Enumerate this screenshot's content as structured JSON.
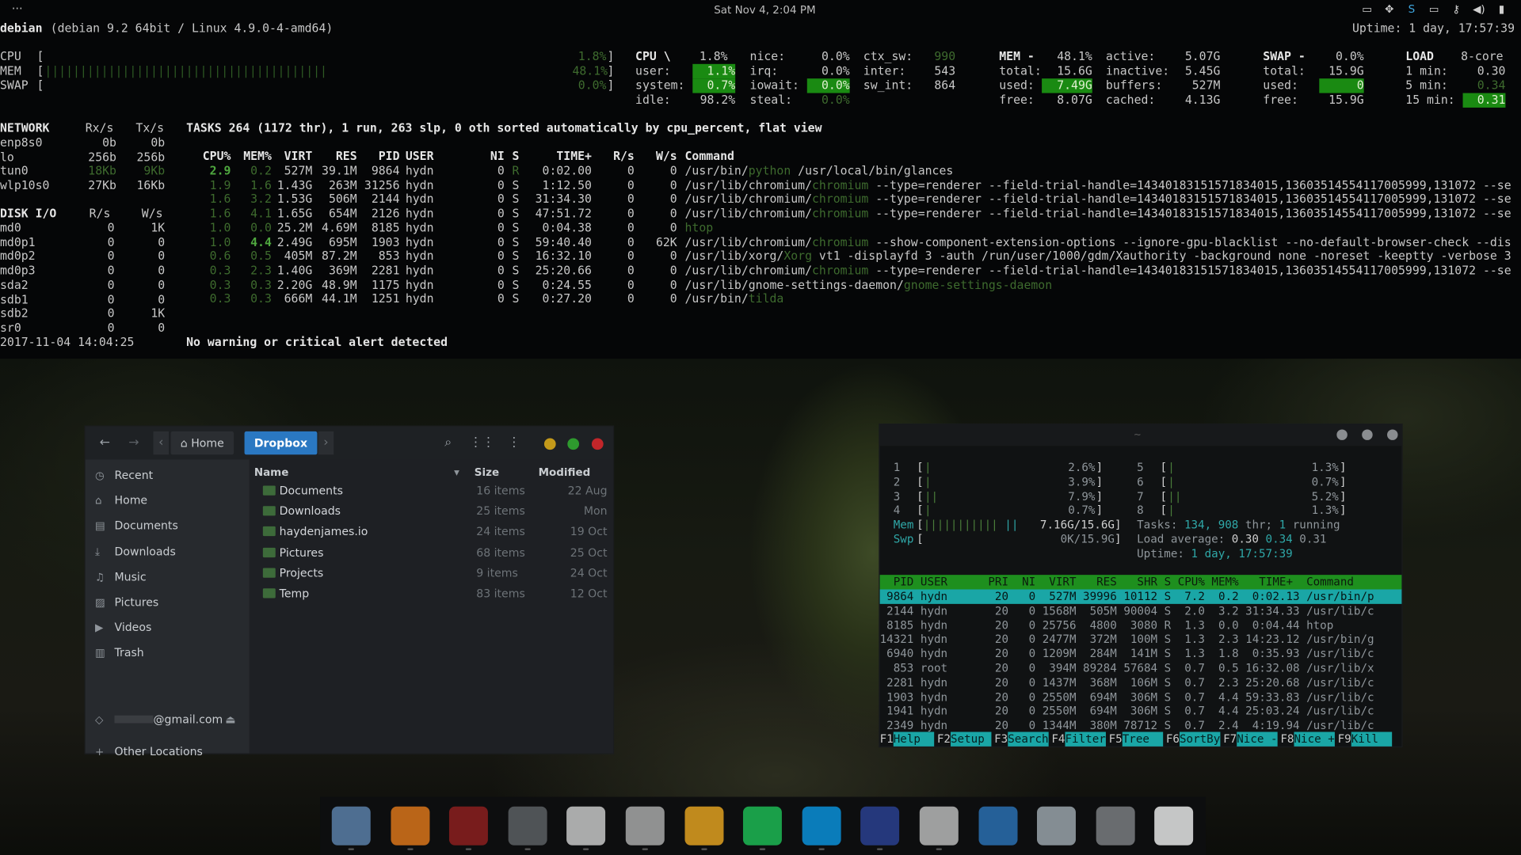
{
  "topbar": {
    "activities": "···",
    "clock": "Sat Nov 4, 2:04 PM",
    "tray_icons": [
      "clipboard-icon",
      "dropbox-icon",
      "skype-icon",
      "display-icon",
      "key-icon",
      "volume-icon",
      "battery-icon"
    ]
  },
  "glances": {
    "host": "debian",
    "os": "(debian 9.2 64bit / Linux 4.9.0-4-amd64)",
    "uptime": "Uptime: 1 day, 17:57:39",
    "quicklook": [
      {
        "label": "CPU",
        "value": "1.8%"
      },
      {
        "label": "MEM",
        "value": "48.1%"
      },
      {
        "label": "SWAP",
        "value": "0.0%"
      }
    ],
    "cpu": {
      "title": "CPU \\",
      "total": "1.8%",
      "user_l": "user:",
      "user": "1.1%",
      "system_l": "system:",
      "system": "0.7%",
      "idle_l": "idle:",
      "idle": "98.2%",
      "nice_l": "nice:",
      "nice": "0.0%",
      "irq_l": "irq:",
      "irq": "0.0%",
      "iowait_l": "iowait:",
      "iowait": "0.0%",
      "steal_l": "steal:",
      "steal": "0.0%",
      "ctx_sw_l": "ctx_sw:",
      "ctx_sw": "990",
      "inter_l": "inter:",
      "inter": "543",
      "sw_int_l": "sw_int:",
      "sw_int": "864"
    },
    "mem": {
      "title": "MEM -",
      "pct": "48.1%",
      "total_l": "total:",
      "total": "15.6G",
      "used_l": "used:",
      "used": "7.49G",
      "free_l": "free:",
      "free": "8.07G",
      "active_l": "active:",
      "active": "5.07G",
      "inactive_l": "inactive:",
      "inactive": "5.45G",
      "buffers_l": "buffers:",
      "buffers": "527M",
      "cached_l": "cached:",
      "cached": "4.13G"
    },
    "swap": {
      "title": "SWAP -",
      "pct": "0.0%",
      "total_l": "total:",
      "total": "15.9G",
      "used_l": "used:",
      "used": "0",
      "free_l": "free:",
      "free": "15.9G"
    },
    "load": {
      "title": "LOAD",
      "cores": "8-core",
      "m1_l": "1 min:",
      "m1": "0.30",
      "m5_l": "5 min:",
      "m5": "0.34",
      "m15_l": "15 min:",
      "m15": "0.31"
    },
    "network": {
      "title": "NETWORK",
      "rx": "Rx/s",
      "tx": "Tx/s",
      "rows": [
        {
          "name": "enp8s0",
          "rx": "0b",
          "tx": "0b"
        },
        {
          "name": "lo",
          "rx": "256b",
          "tx": "256b"
        },
        {
          "name": "tun0",
          "rx": "18Kb",
          "tx": "9Kb"
        },
        {
          "name": "wlp10s0",
          "rx": "27Kb",
          "tx": "16Kb"
        }
      ]
    },
    "diskio": {
      "title": "DISK I/O",
      "r": "R/s",
      "w": "W/s",
      "rows": [
        {
          "name": "md0",
          "r": "0",
          "w": "1K"
        },
        {
          "name": "md0p1",
          "r": "0",
          "w": "0"
        },
        {
          "name": "md0p2",
          "r": "0",
          "w": "0"
        },
        {
          "name": "md0p3",
          "r": "0",
          "w": "0"
        },
        {
          "name": "sda2",
          "r": "0",
          "w": "0"
        },
        {
          "name": "sdb1",
          "r": "0",
          "w": "0"
        },
        {
          "name": "sdb2",
          "r": "0",
          "w": "1K"
        },
        {
          "name": "sr0",
          "r": "0",
          "w": "0"
        }
      ]
    },
    "datetime": "2017-11-04 14:04:25",
    "tasks": "TASKS 264 (1172 thr), 1 run, 263 slp, 0 oth sorted automatically by cpu_percent, flat view",
    "proc_header": {
      "cpu": "CPU%",
      "mem": "MEM%",
      "virt": "VIRT",
      "res": "RES",
      "pid": "PID",
      "user": "USER",
      "ni": "NI",
      "s": "S",
      "time": "TIME+",
      "rs": "R/s",
      "ws": "W/s",
      "cmd": "Command"
    },
    "processes": [
      {
        "cpu": "2.9",
        "mem": "0.2",
        "virt": "527M",
        "res": "39.1M",
        "pid": "9864",
        "user": "hydn",
        "ni": "0",
        "s": "R",
        "time": "0:02.00",
        "rs": "0",
        "ws": "0",
        "pre": "/usr/bin/",
        "prog": "python",
        "post": " /usr/local/bin/glances"
      },
      {
        "cpu": "1.9",
        "mem": "1.6",
        "virt": "1.43G",
        "res": "263M",
        "pid": "31256",
        "user": "hydn",
        "ni": "0",
        "s": "S",
        "time": "1:12.50",
        "rs": "0",
        "ws": "0",
        "pre": "/usr/lib/chromium/",
        "prog": "chromium",
        "post": " --type=renderer --field-trial-handle=14340183151571834015,13603514554117005999,131072 --se"
      },
      {
        "cpu": "1.6",
        "mem": "3.2",
        "virt": "1.53G",
        "res": "506M",
        "pid": "2144",
        "user": "hydn",
        "ni": "0",
        "s": "S",
        "time": "31:34.30",
        "rs": "0",
        "ws": "0",
        "pre": "/usr/lib/chromium/",
        "prog": "chromium",
        "post": " --type=renderer --field-trial-handle=14340183151571834015,13603514554117005999,131072 --se"
      },
      {
        "cpu": "1.6",
        "mem": "4.1",
        "virt": "1.65G",
        "res": "654M",
        "pid": "2126",
        "user": "hydn",
        "ni": "0",
        "s": "S",
        "time": "47:51.72",
        "rs": "0",
        "ws": "0",
        "pre": "/usr/lib/chromium/",
        "prog": "chromium",
        "post": " --type=renderer --field-trial-handle=14340183151571834015,13603514554117005999,131072 --se"
      },
      {
        "cpu": "1.0",
        "mem": "0.0",
        "virt": "25.2M",
        "res": "4.69M",
        "pid": "8185",
        "user": "hydn",
        "ni": "0",
        "s": "S",
        "time": "0:04.38",
        "rs": "0",
        "ws": "0",
        "pre": "",
        "prog": "htop",
        "post": ""
      },
      {
        "cpu": "1.0",
        "mem": "4.4",
        "virt": "2.49G",
        "res": "695M",
        "pid": "1903",
        "user": "hydn",
        "ni": "0",
        "s": "S",
        "time": "59:40.40",
        "rs": "0",
        "ws": "62K",
        "pre": "/usr/lib/chromium/",
        "prog": "chromium",
        "post": " --show-component-extension-options --ignore-gpu-blacklist --no-default-browser-check --dis"
      },
      {
        "cpu": "0.6",
        "mem": "0.5",
        "virt": "405M",
        "res": "87.2M",
        "pid": "853",
        "user": "hydn",
        "ni": "0",
        "s": "S",
        "time": "16:32.10",
        "rs": "0",
        "ws": "0",
        "pre": "/usr/lib/xorg/",
        "prog": "Xorg",
        "post": " vt1 -displayfd 3 -auth /run/user/1000/gdm/Xauthority -background none -noreset -keeptty -verbose 3"
      },
      {
        "cpu": "0.3",
        "mem": "2.3",
        "virt": "1.40G",
        "res": "369M",
        "pid": "2281",
        "user": "hydn",
        "ni": "0",
        "s": "S",
        "time": "25:20.66",
        "rs": "0",
        "ws": "0",
        "pre": "/usr/lib/chromium/",
        "prog": "chromium",
        "post": " --type=renderer --field-trial-handle=14340183151571834015,13603514554117005999,131072 --se"
      },
      {
        "cpu": "0.3",
        "mem": "0.3",
        "virt": "2.20G",
        "res": "48.9M",
        "pid": "1175",
        "user": "hydn",
        "ni": "0",
        "s": "S",
        "time": "0:24.55",
        "rs": "0",
        "ws": "0",
        "pre": "/usr/lib/gnome-settings-daemon/",
        "prog": "gnome-settings-daemon",
        "post": ""
      },
      {
        "cpu": "0.3",
        "mem": "0.3",
        "virt": "666M",
        "res": "44.1M",
        "pid": "1251",
        "user": "hydn",
        "ni": "0",
        "s": "S",
        "time": "0:27.20",
        "rs": "0",
        "ws": "0",
        "pre": "/usr/bin/",
        "prog": "tilda",
        "post": ""
      }
    ],
    "alert": "No warning or critical alert detected"
  },
  "files": {
    "nav_back": "←",
    "nav_forward": "→",
    "crumbs": [
      "Home",
      "Dropbox"
    ],
    "sidebar": [
      {
        "icon": "clock-icon",
        "glyph": "◷",
        "label": "Recent"
      },
      {
        "icon": "home-icon",
        "glyph": "⌂",
        "label": "Home"
      },
      {
        "icon": "document-icon",
        "glyph": "▤",
        "label": "Documents"
      },
      {
        "icon": "download-icon",
        "glyph": "⤓",
        "label": "Downloads"
      },
      {
        "icon": "music-icon",
        "glyph": "♫",
        "label": "Music"
      },
      {
        "icon": "picture-icon",
        "glyph": "▨",
        "label": "Pictures"
      },
      {
        "icon": "video-icon",
        "glyph": "▶",
        "label": "Videos"
      },
      {
        "icon": "trash-icon",
        "glyph": "▥",
        "label": "Trash"
      }
    ],
    "account": "@gmail.com",
    "other_locations": "Other Locations",
    "columns": {
      "name": "Name",
      "size": "Size",
      "modified": "Modified"
    },
    "rows": [
      {
        "name": "Documents",
        "size": "16 items",
        "modified": "22 Aug"
      },
      {
        "name": "Downloads",
        "size": "25 items",
        "modified": "Mon"
      },
      {
        "name": "haydenjames.io",
        "size": "24 items",
        "modified": "19 Oct"
      },
      {
        "name": "Pictures",
        "size": "68 items",
        "modified": "25 Oct"
      },
      {
        "name": "Projects",
        "size": "9 items",
        "modified": "24 Oct"
      },
      {
        "name": "Temp",
        "size": "83 items",
        "modified": "12 Oct"
      }
    ]
  },
  "htop": {
    "title": "~",
    "cpus": [
      {
        "n": "1",
        "v": "2.6%"
      },
      {
        "n": "2",
        "v": "3.9%"
      },
      {
        "n": "3",
        "v": "7.9%"
      },
      {
        "n": "4",
        "v": "0.7%"
      },
      {
        "n": "5",
        "v": "1.3%"
      },
      {
        "n": "6",
        "v": "0.7%"
      },
      {
        "n": "7",
        "v": "5.2%"
      },
      {
        "n": "8",
        "v": "1.3%"
      }
    ],
    "mem": "7.16G/15.6G",
    "swp": "0K/15.9G",
    "tasks_l": "Tasks:",
    "tasks": "134,",
    "thr": "908",
    "thr_l": "thr;",
    "running": "1",
    "running_l": "running",
    "load_l": "Load average:",
    "load1": "0.30",
    "load5": "0.34",
    "load15": "0.31",
    "uptime_l": "Uptime:",
    "uptime": "1 day, 17:57:39",
    "header": "  PID USER      PRI  NI  VIRT   RES   SHR S CPU% MEM%   TIME+  Command",
    "rows": [
      " 9864 hydn       20   0  527M 39996 10112 S  7.2  0.2  0:02.13 /usr/bin/p",
      " 2144 hydn       20   0 1568M  505M 90004 S  2.0  3.2 31:34.33 /usr/lib/c",
      " 8185 hydn       20   0 25756  4800  3080 R  1.3  0.0  0:04.44 htop",
      "14321 hydn       20   0 2477M  372M  100M S  1.3  2.3 14:23.12 /usr/bin/g",
      " 6940 hydn       20   0 1209M  284M  141M S  1.3  1.8  0:35.93 /usr/lib/c",
      "  853 root       20   0  394M 89284 57684 S  0.7  0.5 16:32.08 /usr/lib/x",
      " 2281 hydn       20   0 1437M  368M  106M S  0.7  2.3 25:20.68 /usr/lib/c",
      " 1903 hydn       20   0 2550M  694M  306M S  0.7  4.4 59:33.83 /usr/lib/c",
      " 1941 hydn       20   0 2550M  694M  306M S  0.7  4.4 25:03.24 /usr/lib/c",
      " 2349 hydn       20   0 1344M  380M 78712 S  0.7  2.4  4:19.94 /usr/lib/c"
    ],
    "fkeys": [
      {
        "k": "F1",
        "v": "Help  "
      },
      {
        "k": "F2",
        "v": "Setup "
      },
      {
        "k": "F3",
        "v": "Search"
      },
      {
        "k": "F4",
        "v": "Filter"
      },
      {
        "k": "F5",
        "v": "Tree  "
      },
      {
        "k": "F6",
        "v": "SortBy"
      },
      {
        "k": "F7",
        "v": "Nice -"
      },
      {
        "k": "F8",
        "v": "Nice +"
      },
      {
        "k": "F9",
        "v": "Kill  "
      }
    ]
  },
  "dock": [
    {
      "name": "chromium-icon",
      "color": "#5b7fa8"
    },
    {
      "name": "firefox-icon",
      "color": "#d9741a"
    },
    {
      "name": "terminal-icon",
      "color": "#8c1e1e"
    },
    {
      "name": "files-icon",
      "color": "#5c5f63"
    },
    {
      "name": "text-editor-icon",
      "color": "#c7c7c7"
    },
    {
      "name": "documents-icon",
      "color": "#a8a8a8"
    },
    {
      "name": "photos-icon",
      "color": "#e0a020"
    },
    {
      "name": "spotify-icon",
      "color": "#1db954"
    },
    {
      "name": "skype-icon",
      "color": "#0a8fd8"
    },
    {
      "name": "contacts-icon",
      "color": "#2a3f8f"
    },
    {
      "name": "calendar-icon",
      "color": "#b8b8b8"
    },
    {
      "name": "system-monitor-icon",
      "color": "#2a6fb0"
    },
    {
      "name": "software-icon",
      "color": "#9aa3aa"
    },
    {
      "name": "settings-icon",
      "color": "#7a7d80"
    },
    {
      "name": "app-grid-icon",
      "color": "#e6e6e6"
    }
  ]
}
